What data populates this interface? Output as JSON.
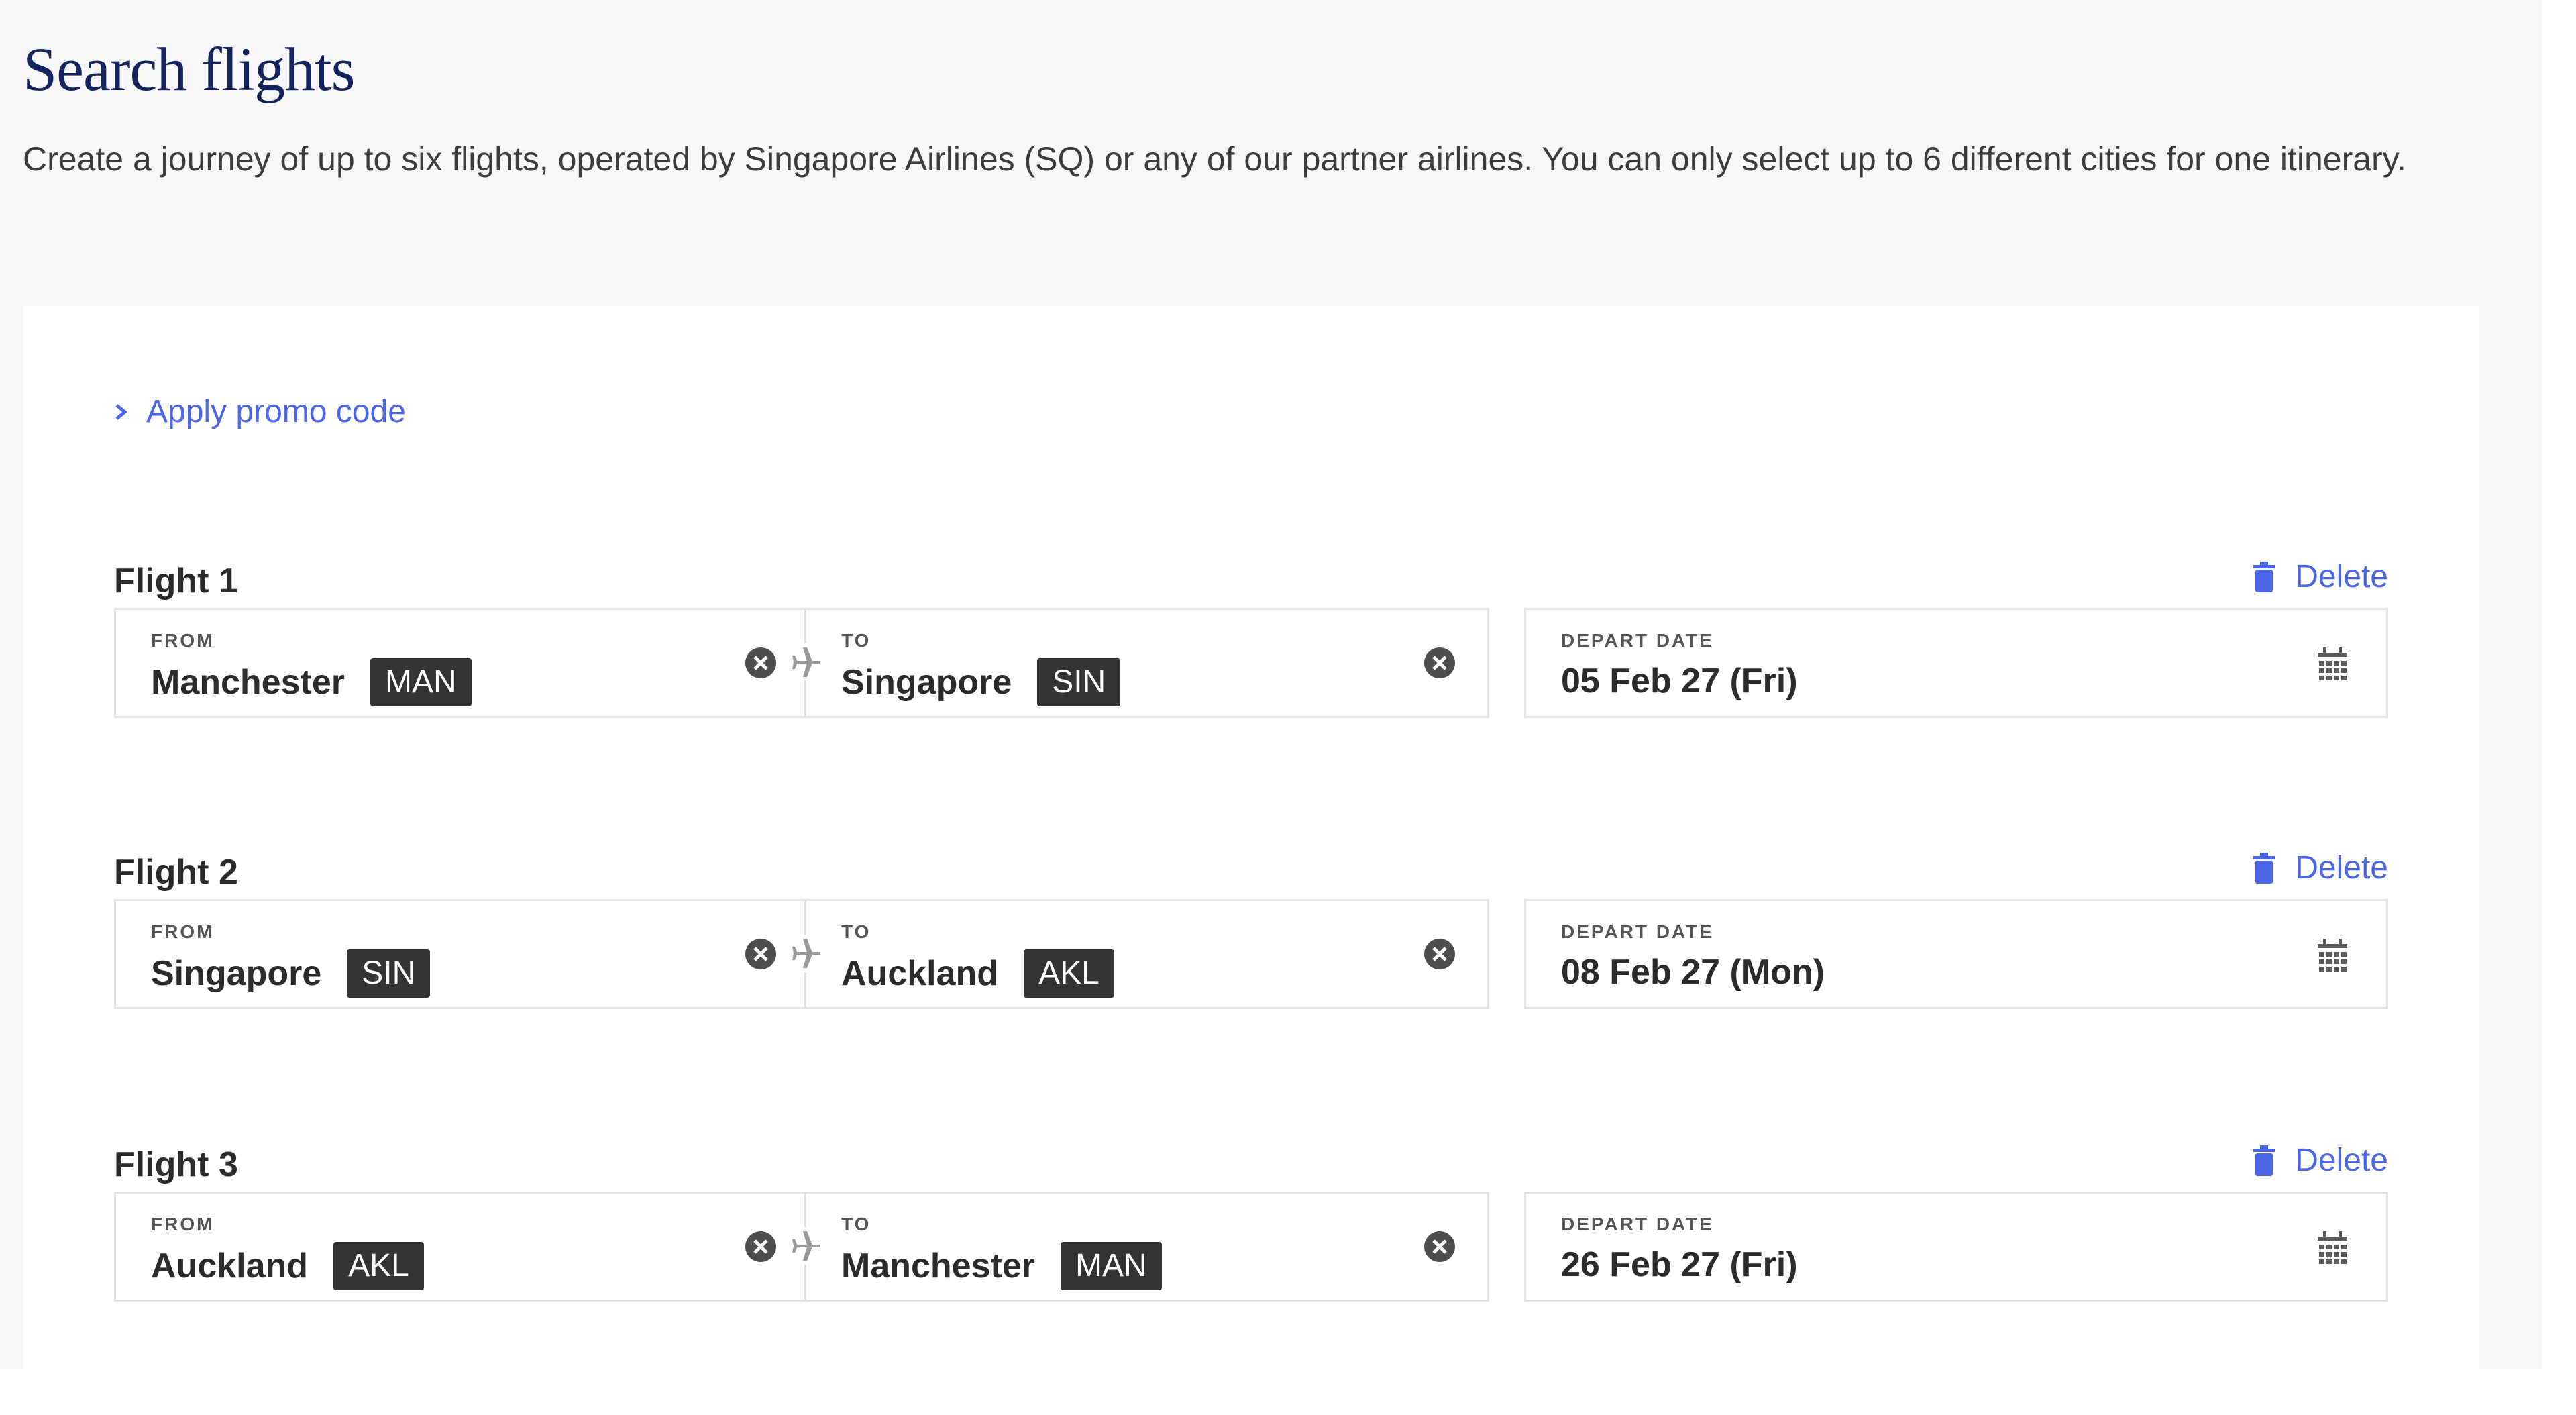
{
  "page": {
    "title": "Search flights",
    "intro": "Create a journey of up to six flights, operated by Singapore Airlines (SQ) or any of our partner airlines. You can only select up to 6 different cities for one itinerary."
  },
  "promo": {
    "label": "Apply promo code"
  },
  "labels": {
    "from": "FROM",
    "to": "TO",
    "depart": "DEPART DATE",
    "delete": "Delete"
  },
  "flights": [
    {
      "title": "Flight 1",
      "from_city": "Manchester",
      "from_code": "MAN",
      "to_city": "Singapore",
      "to_code": "SIN",
      "date": "05 Feb 27 (Fri)"
    },
    {
      "title": "Flight 2",
      "from_city": "Singapore",
      "from_code": "SIN",
      "to_city": "Auckland",
      "to_code": "AKL",
      "date": "08 Feb 27 (Mon)"
    },
    {
      "title": "Flight 3",
      "from_city": "Auckland",
      "from_code": "AKL",
      "to_city": "Manchester",
      "to_code": "MAN",
      "date": "26 Feb 27 (Fri)"
    }
  ],
  "colors": {
    "title": "#13235b",
    "accent": "#4a65e8",
    "code_badge": "#333333",
    "background": "#f7f7f9"
  },
  "icons": {
    "delete": "trash-icon",
    "clear": "clear-circle-icon",
    "route": "plane-icon",
    "date": "calendar-icon",
    "promo": "chevron-right-icon"
  }
}
